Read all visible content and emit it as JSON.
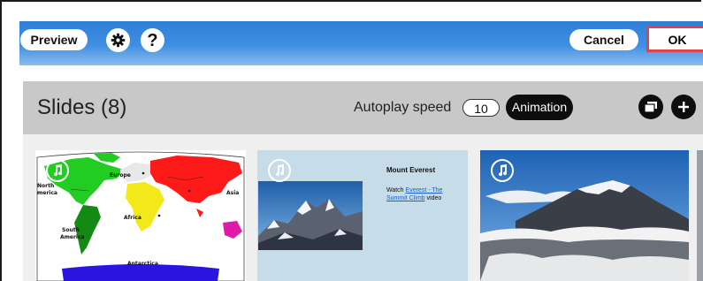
{
  "toolbar": {
    "preview_label": "Preview",
    "cancel_label": "Cancel",
    "ok_label": "OK",
    "settings_icon": "gear-icon",
    "help_icon": "question-icon",
    "help_symbol": "?"
  },
  "slides_panel": {
    "title": "Slides (8)",
    "autoplay_label": "Autoplay speed",
    "autoplay_value": "10",
    "animation_label": "Animation"
  },
  "slides": [
    {
      "kind": "world-map",
      "labels": {
        "europe": "Europe",
        "asia": "Asia",
        "north_america": "North\nmerica",
        "south_america": "South\nAmerica",
        "africa": "Africa",
        "antarctica": "Antarctica"
      }
    },
    {
      "kind": "mount-everest",
      "heading": "Mount Everest",
      "watch_prefix": "Watch ",
      "link_text": "Everest - The Summit Climb",
      "watch_suffix": " video"
    },
    {
      "kind": "mountain-photo"
    }
  ],
  "colors": {
    "toolbar_blue": "#3a8ae0",
    "ok_border": "#e0414b",
    "panel_gray": "#c8c8c8",
    "slide2_bg": "#c6dce8"
  }
}
